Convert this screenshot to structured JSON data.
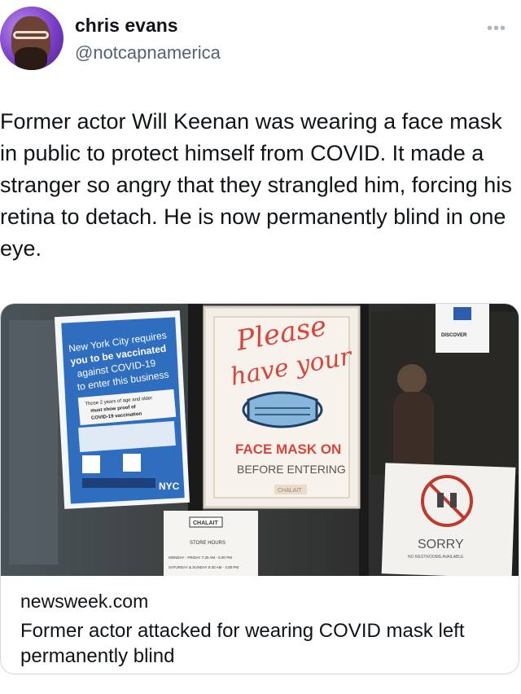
{
  "author": {
    "name": "chris evans",
    "handle": "@notcapnamerica"
  },
  "menu": {
    "icon": "more-icon"
  },
  "tweet": {
    "text": "Former actor Will Keenan was wearing a face mask in public to protect himself from COVID.  It made a stranger so angry that they strangled him, forcing his retina to detach. He is now permanently blind in one eye."
  },
  "card": {
    "domain": "newsweek.com",
    "title": "Former actor attacked for wearing COVID mask left permanently blind"
  },
  "photo": {
    "sign_left": {
      "l1": "New York City requires",
      "l2": "you to be vaccinated",
      "l3": "against COVID-19",
      "l4": "to enter this business",
      "l5": "Those 2 years of age and older",
      "l6": "must show proof of",
      "l7": "COVID-19 vaccination",
      "logo": "NYC"
    },
    "sign_center": {
      "script1": "Please",
      "script2": "have your",
      "mask1": "FACE MASK ON",
      "mask2": "BEFORE ENTERING",
      "brand": "CHALAIT"
    },
    "sign_hours": {
      "brand": "CHALAIT",
      "title": "STORE HOURS",
      "l1": "MONDAY - FRIDAY 7:30 AM - 5:00 PM",
      "l2": "SATURDAY & SUNDAY 8:30 AM - 4:00 PM"
    },
    "sign_sorry": {
      "word": "SORRY",
      "note": "NO RESTROOMS AVAILABLE"
    },
    "discover": "DISCOVER"
  }
}
